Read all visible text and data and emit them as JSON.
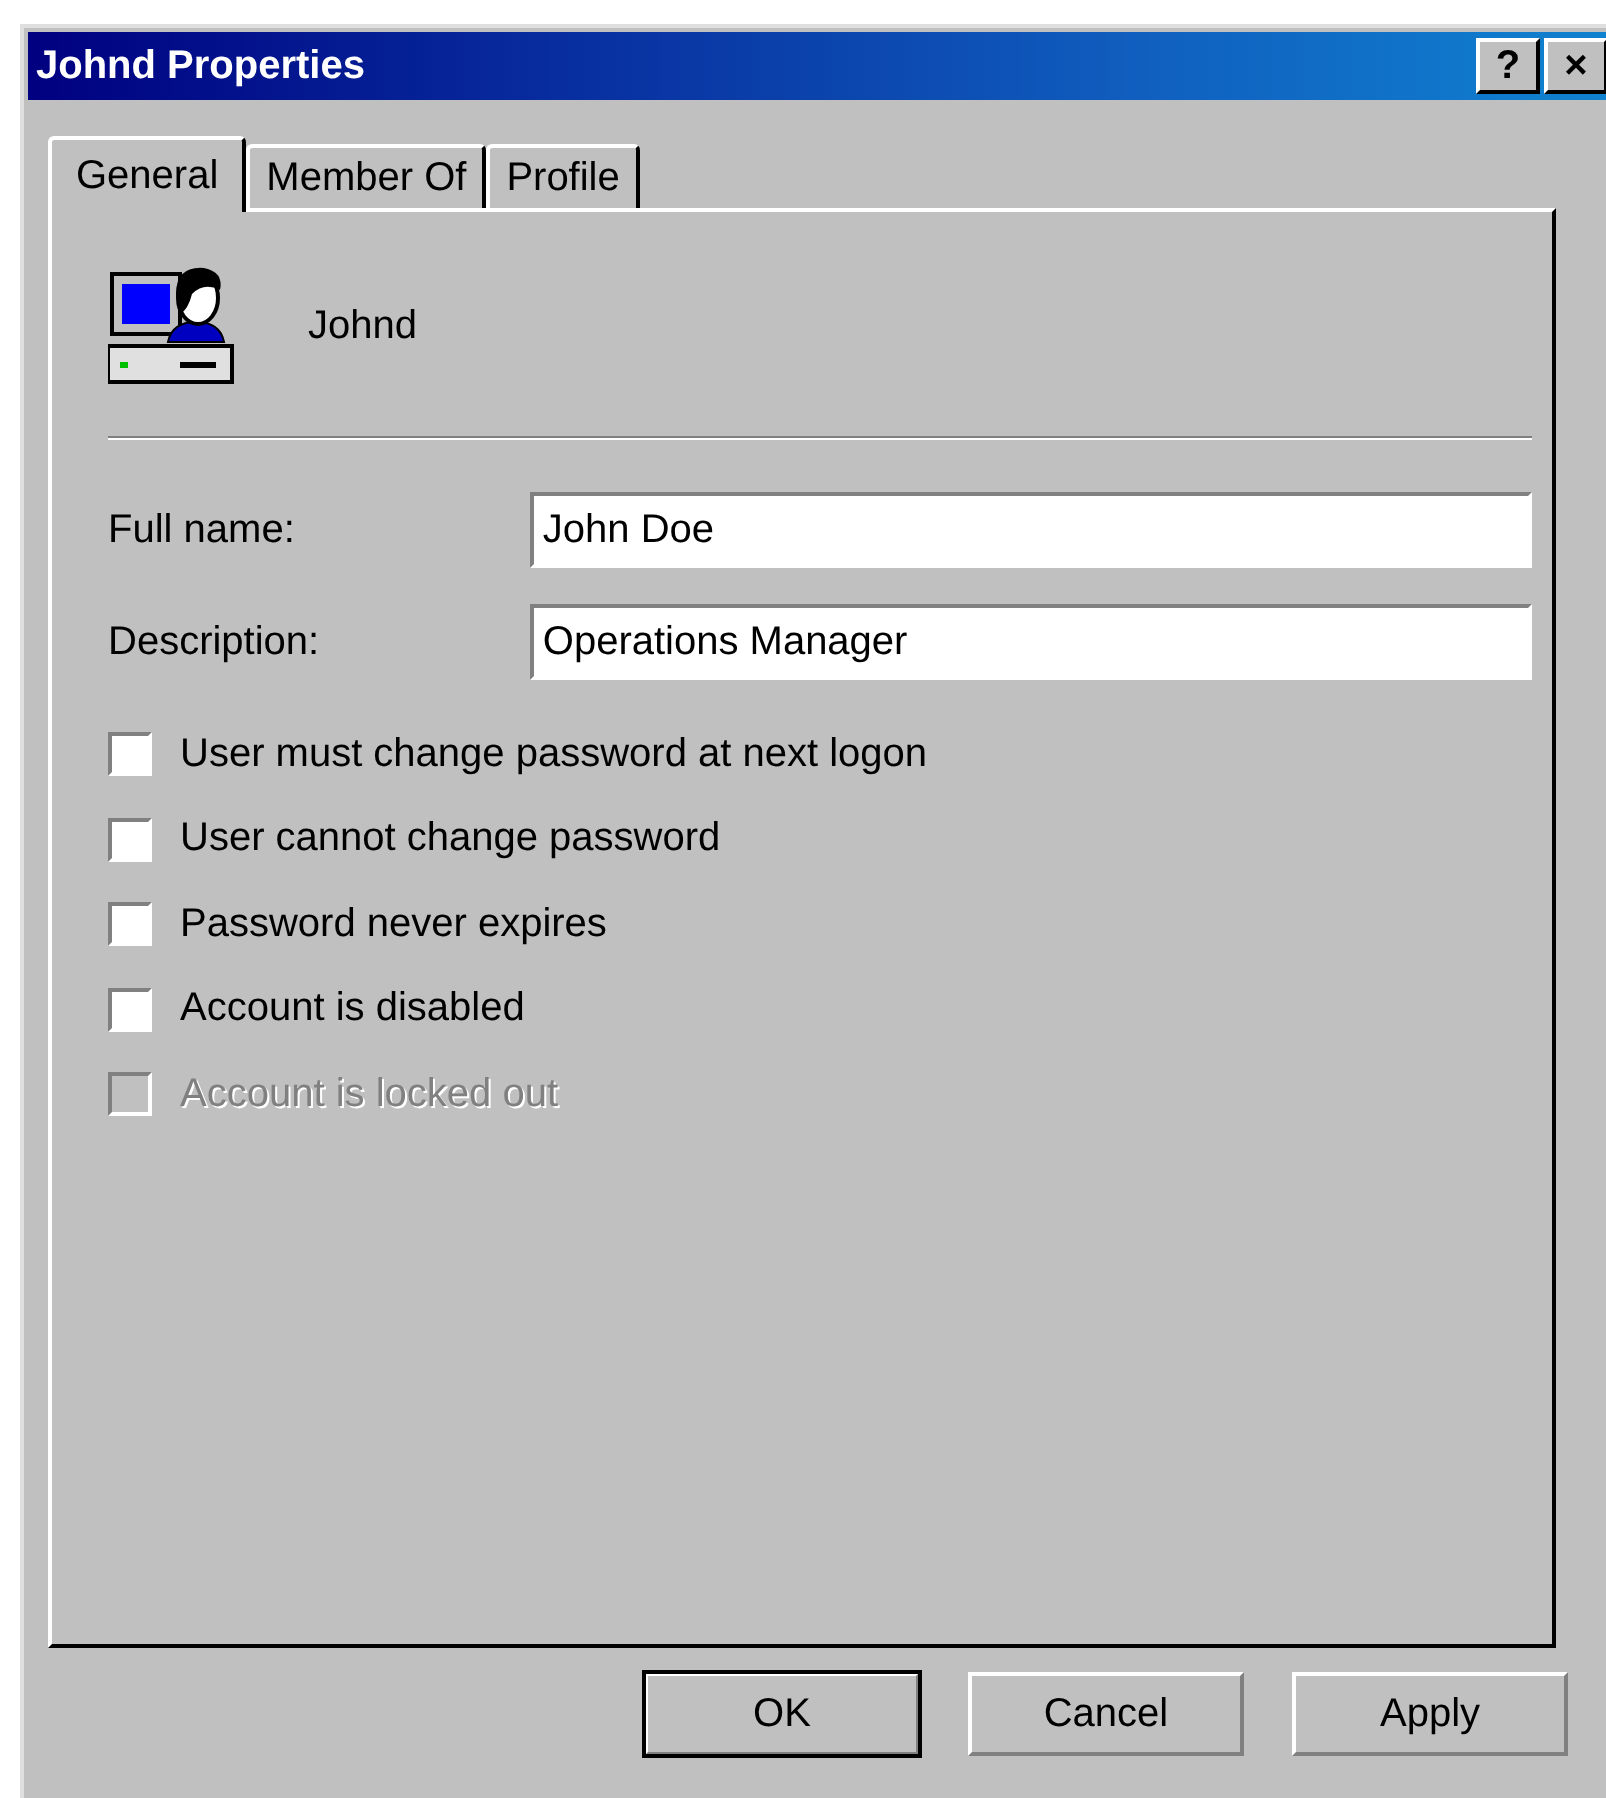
{
  "window": {
    "title": "Johnd Properties",
    "title_buttons": [
      "?",
      "×"
    ]
  },
  "tabs": [
    {
      "label": "General",
      "selected": true
    },
    {
      "label": "Member Of",
      "selected": false
    },
    {
      "label": "Profile",
      "selected": false
    }
  ],
  "user": {
    "name": "Johnd"
  },
  "fields": [
    {
      "label": "Full name:",
      "value": "John Doe"
    },
    {
      "label": "Description:",
      "value": "Operations Manager"
    }
  ],
  "options": [
    {
      "label": "User must change password at next logon",
      "checked": false,
      "disabled": false
    },
    {
      "label": "User cannot change password",
      "checked": false,
      "disabled": false
    },
    {
      "label": "Password never expires",
      "checked": false,
      "disabled": false
    },
    {
      "label": "Account is disabled",
      "checked": false,
      "disabled": false
    },
    {
      "label": "Account is locked out",
      "checked": false,
      "disabled": true
    }
  ],
  "buttons": [
    {
      "label": "OK",
      "default": true
    },
    {
      "label": "Cancel",
      "default": false
    },
    {
      "label": "Apply",
      "default": false
    }
  ]
}
